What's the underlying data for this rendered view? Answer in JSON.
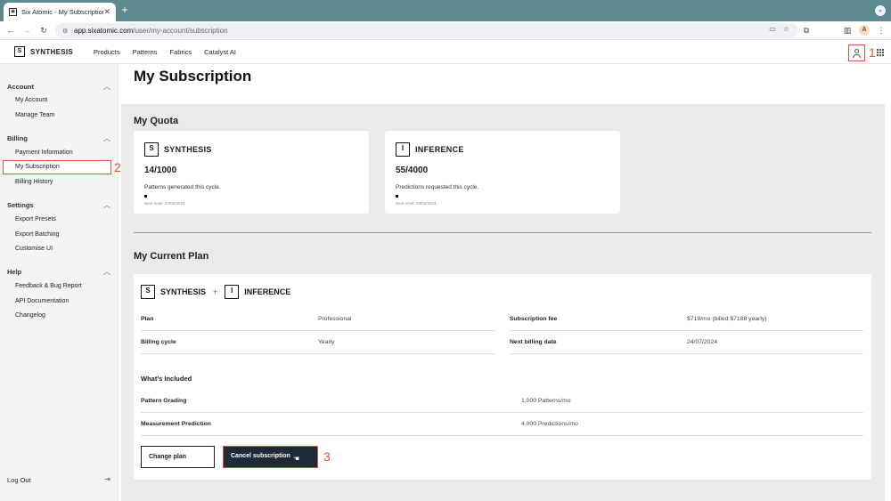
{
  "browser": {
    "tab_title": "Six Atomic - My Subscription",
    "url_domain": "app.sixatomic.com",
    "url_path": "/user/my-account/subscription",
    "avatar_letter": "A"
  },
  "header": {
    "logo_letter": "S",
    "logo_text": "SYNTHESIS",
    "nav": [
      "Products",
      "Patterns",
      "Fabrics",
      "Catalyst AI"
    ],
    "marker": "1"
  },
  "sidebar": {
    "sections": [
      {
        "title": "Account",
        "items": [
          "My Account",
          "Manage Team"
        ]
      },
      {
        "title": "Billing",
        "items": [
          "Payment Information",
          "My Subscription",
          "Billing History"
        ]
      },
      {
        "title": "Settings",
        "items": [
          "Export Presets",
          "Export Batching",
          "Customise UI"
        ]
      },
      {
        "title": "Help",
        "items": [
          "Feedback & Bug Report",
          "API Documentation",
          "Changelog"
        ]
      }
    ],
    "active_marker": "2",
    "logout": "Log Out"
  },
  "main": {
    "title": "My Subscription",
    "quota_heading": "My Quota",
    "quota_cards": [
      {
        "letter": "S",
        "name": "SYNTHESIS",
        "count": "14/1000",
        "fraction": 0.014,
        "desc": "Patterns generated this cycle.",
        "reset": "Next reset: 24/04/2024"
      },
      {
        "letter": "I",
        "name": "INFERENCE",
        "count": "55/4000",
        "fraction": 0.014,
        "desc": "Predictions requested this cycle.",
        "reset": "Next reset: 24/04/2024"
      }
    ],
    "plan_heading": "My Current Plan",
    "plan": {
      "brand1_letter": "S",
      "brand1": "SYNTHESIS",
      "plus": "+",
      "brand2_letter": "I",
      "brand2": "INFERENCE",
      "plan_label": "Plan",
      "plan_value": "Professional",
      "fee_label": "Subscription fee",
      "fee_value": "$719/mo (billed $7188 yearly)",
      "cycle_label": "Billing cycle",
      "cycle_value": "Yearly",
      "next_label": "Next billing date",
      "next_value": "24/07/2024",
      "included_heading": "What’s Included",
      "included": [
        {
          "label": "Pattern Grading",
          "value": "1,000 Patterns/mo"
        },
        {
          "label": "Measurement Prediction",
          "value": "4,000 Predictions/mo"
        }
      ],
      "change_btn": "Change plan",
      "cancel_btn": "Cancel subscription",
      "cancel_marker": "3"
    }
  },
  "colors": {
    "highlight": "#e0533b",
    "primary_btn": "#1e2a38",
    "panel": "#eaeaea"
  }
}
